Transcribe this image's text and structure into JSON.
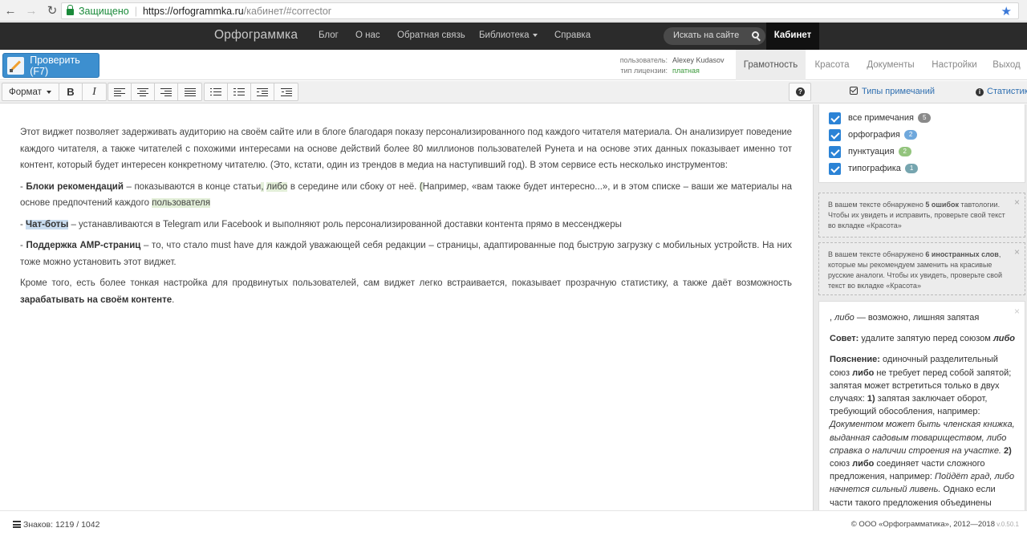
{
  "browser": {
    "secure_label": "Защищено",
    "url_host": "https://orfogrammka.ru",
    "url_path": "/кабинет/#corrector"
  },
  "site": {
    "brand": "Орфограммка",
    "nav": [
      "Блог",
      "О нас",
      "Обратная связь",
      "Библиотека",
      "Справка"
    ],
    "search_placeholder": "Искать на сайте",
    "cabinet": "Кабинет"
  },
  "control": {
    "check_label": "Проверить (F7)",
    "user_label": "пользователь:",
    "user_name": "Alexey Kudasov",
    "license_label": "тип лицензии:",
    "license_value": "платная",
    "tabs": [
      "Грамотность",
      "Красота",
      "Документы",
      "Настройки",
      "Выход"
    ]
  },
  "toolbar": {
    "format_label": "Формат",
    "bold": "B",
    "italic": "I",
    "help": "?",
    "types_link": "Типы примечаний",
    "stats_link": "Статистика"
  },
  "editor": {
    "p1": "Этот виджет позволяет задерживать аудиторию на своём сайте или в блоге благодаря показу персонализированного под каждого читателя материала. Он анализирует поведение каждого читателя, а также читателей с похожими интересами на основе действий более 80 миллионов пользователей Рунета и на основе этих данных показывает именно тот контент, который будет интересен конкретному читателю. (Это, кстати, один из трендов в медиа на наступивший год). В этом сервисе есть несколько инструментов:",
    "p2_dash": "- ",
    "p2_bold": "Блоки рекомендаций",
    "p2_a": " – показываются в конце статьи",
    "p2_comma": ",",
    "p2_b": " ",
    "p2_libo": "либо",
    "p2_c": " в середине или сбоку от неё. ",
    "p2_paren": "(",
    "p2_d": "Например, «вам также будет интересно...», и в этом списке – ваши же материалы на основе предпочтений каждого ",
    "p2_user": "пользователя",
    "p3_dash": "- ",
    "p3_bold": "Чат-боты",
    "p3_rest": " – устанавливаются в Telegram или Facebook и выполняют роль персонализированной доставки контента прямо в мессенджеры",
    "p4_dash": "- ",
    "p4_bold": "Поддержка AMP-страниц",
    "p4_rest": " – то, что стало must have для каждой уважающей себя редакции – страницы, адаптированные под быструю загрузку с мобильных устройств. На них тоже можно установить этот виджет.",
    "p5_rest": "Кроме того, есть более тонкая настройка для продвинутых пользователей, сам виджет легко встраивается, показывает прозрачную статистику, а также даёт возможность ",
    "p5_bold": "зарабатывать на своём контенте",
    "p5_end": "."
  },
  "types": [
    {
      "label": "все примечания",
      "count": "5",
      "color": "#8a8a8a"
    },
    {
      "label": "орфография",
      "count": "2",
      "color": "#6fa8dc"
    },
    {
      "label": "пунктуация",
      "count": "2",
      "color": "#93c47d"
    },
    {
      "label": "типографика",
      "count": "1",
      "color": "#76a5af"
    }
  ],
  "notes": {
    "n1_a": "В вашем тексте обнаружено ",
    "n1_b": "5 ошибок",
    "n1_c": " тавтологии. Чтобы их увидеть и исправить, проверьте свой текст во вкладке «Красота»",
    "n2_a": "В вашем тексте обнаружено ",
    "n2_b": "6 иностранных слов",
    "n2_c": ", которые мы рекомендуем заменить на красивые русские аналоги. Чтобы их увидеть, проверьте свой текст во вкладке «Красота»",
    "close": "×"
  },
  "explanation": {
    "head_a": ", ",
    "head_libo": "либо",
    "head_b": " — возможно, лишняя запятая",
    "tip_label": "Совет:",
    "tip_text": " удалите запятую перед союзом ",
    "tip_word": "либо",
    "exp_label": "Пояснение:",
    "exp_1": " одиночный разделительный союз ",
    "exp_libo1": "либо",
    "exp_2": " не требует перед собой запятой; запятая может встретиться только в двух случаях: ",
    "exp_n1": "1)",
    "exp_3": " запятая заключает оборот, требующий обособления, например: ",
    "exp_ex1": "Документом может быть членская книжка, выданная садовым товариществом, либо справка о наличии строения на участке.",
    "exp_n2": " 2)",
    "exp_4": " союз ",
    "exp_libo2": "либо",
    "exp_5": " соединяет части сложного предложения, например: ",
    "exp_ex2": "Пойдёт град, либо начнется сильный ливень.",
    "exp_6": " Однако если части такого предложения объединены общим"
  },
  "footer": {
    "chars_label": "Знаков:",
    "chars_value": "1219 / 1042",
    "copyright": "© ООО «Орфограмматика», 2012—2018",
    "version": "v.0.50.1"
  }
}
